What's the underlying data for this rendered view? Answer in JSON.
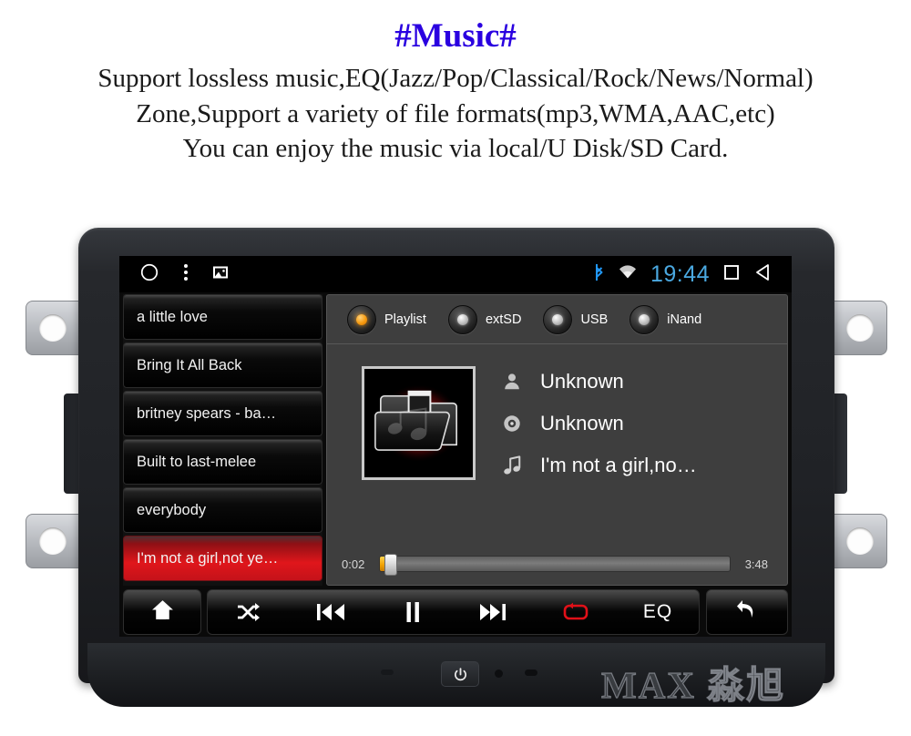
{
  "header": {
    "title": "#Music#",
    "lines": [
      "Support lossless music,EQ(Jazz/Pop/Classical/Rock/News/Normal)",
      "Zone,Support a variety of file formats(mp3,WMA,AAC,etc)",
      "You can enjoy the music via local/U Disk/SD Card."
    ],
    "title_color": "#2a00e0"
  },
  "statusbar": {
    "home_icon": "circle-icon",
    "menu_icon": "overflow-menu-icon",
    "gallery_icon": "image-icon",
    "bluetooth_icon": "bluetooth-icon",
    "wifi_icon": "wifi-icon",
    "time": "19:44",
    "time_color": "#4aa8e0",
    "recents_icon": "square-recents-icon",
    "back_icon": "back-triangle-icon"
  },
  "playlist": {
    "items": [
      {
        "label": "a little love",
        "selected": false
      },
      {
        "label": "Bring It All Back",
        "selected": false
      },
      {
        "label": "britney spears - ba…",
        "selected": false
      },
      {
        "label": "Built to last-melee",
        "selected": false
      },
      {
        "label": "everybody",
        "selected": false
      },
      {
        "label": "I'm not a girl,not ye…",
        "selected": true
      }
    ],
    "selected_color": "#e0161b"
  },
  "sources": {
    "options": [
      {
        "label": "Playlist",
        "selected": true
      },
      {
        "label": "extSD",
        "selected": false
      },
      {
        "label": "USB",
        "selected": false
      },
      {
        "label": "iNand",
        "selected": false
      }
    ],
    "selected_indicator_color": "#f79b10"
  },
  "now_playing": {
    "album_art": "music-folder-icon",
    "artist_icon": "person-icon",
    "artist": "Unknown",
    "album_icon": "disc-icon",
    "album": "Unknown",
    "title_icon": "music-note-icon",
    "title": "I'm not a girl,no…",
    "elapsed": "0:02",
    "duration": "3:48",
    "progress_percent": 1
  },
  "controls": {
    "home": "home-icon",
    "shuffle": "shuffle-icon",
    "previous": "previous-track-icon",
    "playpause": "pause-icon",
    "next": "next-track-icon",
    "repeat": "repeat-icon",
    "repeat_color": "#e01018",
    "eq_label": "EQ",
    "back": "back-arrow-icon"
  },
  "device": {
    "power_button": "power-icon",
    "watermark": "MAX 淼旭"
  }
}
